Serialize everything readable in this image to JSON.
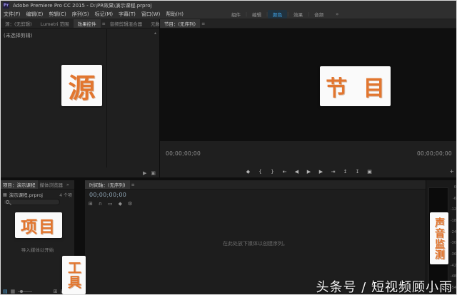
{
  "window": {
    "app_icon": "Pr",
    "title": "Adobe Premiere Pro CC 2015 - D:\\PR效果\\演示课程.prproj"
  },
  "menu_bar": {
    "items": [
      "文件(F)",
      "编辑(E)",
      "剪辑(C)",
      "序列(S)",
      "标记(M)",
      "字幕(T)",
      "窗口(W)",
      "帮助(H)"
    ]
  },
  "workspace_bar": {
    "tabs": [
      {
        "label": "组件",
        "active": false
      },
      {
        "label": "编辑",
        "active": false
      },
      {
        "label": "颜色",
        "active": true
      },
      {
        "label": "效果",
        "active": false
      },
      {
        "label": "音频",
        "active": false
      }
    ],
    "separator": "|",
    "overflow": "»",
    "active_color": "#41a8ee"
  },
  "source_panel": {
    "tabs": [
      {
        "label": "源：(无剪辑)",
        "active": false
      },
      {
        "label": "Lumetri 范围",
        "active": false
      },
      {
        "label": "效果控件",
        "active": true
      },
      {
        "label": "音频剪辑混合器",
        "active": false
      },
      {
        "label": "元数据",
        "active": false
      }
    ],
    "panel_menu_icon": "≡",
    "scroll_up_icon": "▴",
    "empty_text": "(未选择剪辑)",
    "footer_icons": [
      {
        "id": "play-in-to-out",
        "glyph": "▶"
      },
      {
        "id": "comparison-view",
        "glyph": "▣"
      }
    ]
  },
  "program_panel": {
    "tab": "节目：(无序列)",
    "panel_menu_icon": "≡",
    "timecode_current": "00;00;00;00",
    "timecode_duration": "00;00;00;00",
    "transport": [
      {
        "id": "add-marker",
        "glyph": "◆"
      },
      {
        "id": "mark-in",
        "glyph": "{"
      },
      {
        "id": "mark-out",
        "glyph": "}"
      },
      {
        "id": "go-to-in",
        "glyph": "⇤"
      },
      {
        "id": "step-back",
        "glyph": "◀"
      },
      {
        "id": "play",
        "glyph": "▶"
      },
      {
        "id": "step-forward",
        "glyph": "▶"
      },
      {
        "id": "go-to-out",
        "glyph": "⇥"
      },
      {
        "id": "lift",
        "glyph": "↥"
      },
      {
        "id": "extract",
        "glyph": "↧"
      },
      {
        "id": "export-frame",
        "glyph": "▣"
      }
    ],
    "button_editor": "+"
  },
  "project_panel": {
    "tab_project": "项目：演示课程",
    "tab_media_browser": "媒体浏览器",
    "panel_menu_icon": "≡",
    "overflow": "»",
    "project_file_icon": "▦",
    "project_file": "演示课程.prproj",
    "item_count": "4 个项",
    "empty_text": "导入媒体以开始",
    "footer": {
      "list_view": "▤",
      "icon_view": "▦",
      "new_bin": "⊞",
      "new_item": "▣",
      "clear": "✕"
    }
  },
  "tools_panel": {
    "tools": [
      {
        "id": "selection-tool",
        "glyph": "↖"
      },
      {
        "id": "track-select-tool",
        "glyph": "⇥"
      },
      {
        "id": "ripple-edit-tool",
        "glyph": "⇄"
      },
      {
        "id": "razor-tool",
        "glyph": "∕"
      },
      {
        "id": "slip-tool",
        "glyph": "⇋"
      },
      {
        "id": "pen-tool",
        "glyph": "◆"
      },
      {
        "id": "hand-tool",
        "glyph": "⊙"
      },
      {
        "id": "zoom-tool",
        "glyph": "⊕"
      }
    ]
  },
  "timeline_panel": {
    "tab": "时间轴：(无序列)",
    "panel_menu_icon": "≡",
    "timecode": "00;00;00;00",
    "toolbar": [
      {
        "id": "insert-overwrite",
        "glyph": "⊞"
      },
      {
        "id": "snap",
        "glyph": "∩"
      },
      {
        "id": "linked-selection",
        "glyph": "▭"
      },
      {
        "id": "add-marker",
        "glyph": "◆"
      },
      {
        "id": "timeline-settings",
        "glyph": "⚙"
      }
    ],
    "empty_text": "在此处放下媒体以创建序列。"
  },
  "audio_meter_panel": {
    "ticks": [
      "0",
      "-6",
      "-12",
      "-18",
      "-24",
      "-30",
      "-36",
      "-42",
      "-48",
      "-54"
    ]
  },
  "annotations": {
    "source": "源",
    "program": "节 目",
    "project": "项目",
    "tools": "工具",
    "audio": "声音监测",
    "color": "#e2762f"
  },
  "watermark": {
    "text": "头条号 / 短视频顾小雨"
  }
}
